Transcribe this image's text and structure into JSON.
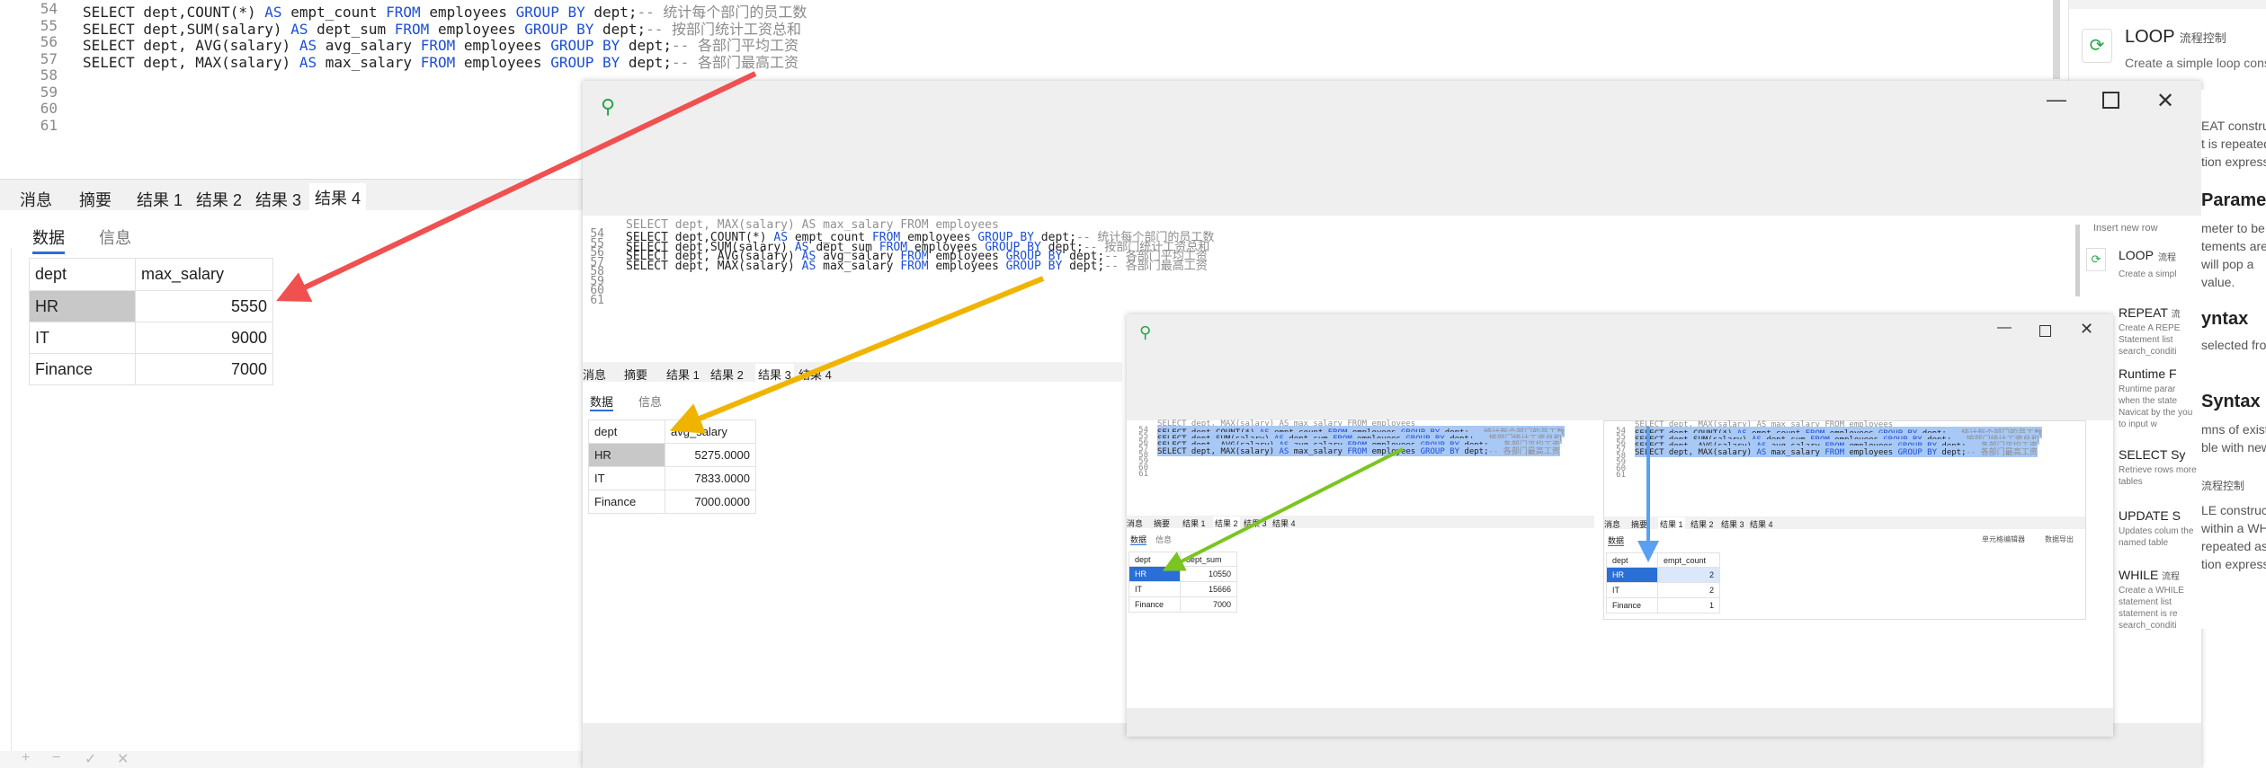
{
  "editor": {
    "lines": [
      {
        "n": "54",
        "parts": [
          {
            "t": "SELECT dept,COUNT(*) ",
            "c": ""
          },
          {
            "t": "AS",
            "c": "kw"
          },
          {
            "t": " empt_count ",
            "c": ""
          },
          {
            "t": "FROM",
            "c": "kw"
          },
          {
            "t": " employees ",
            "c": ""
          },
          {
            "t": "GROUP BY",
            "c": "kw"
          },
          {
            "t": " dept;",
            "c": ""
          },
          {
            "t": "-- 统计每个部门的员工数",
            "c": "cm"
          }
        ]
      },
      {
        "n": "55",
        "parts": [
          {
            "t": "SELECT dept,SUM(salary) ",
            "c": ""
          },
          {
            "t": "AS",
            "c": "kw"
          },
          {
            "t": " dept_sum ",
            "c": ""
          },
          {
            "t": "FROM",
            "c": "kw"
          },
          {
            "t": " employees ",
            "c": ""
          },
          {
            "t": "GROUP BY",
            "c": "kw"
          },
          {
            "t": " dept;",
            "c": ""
          },
          {
            "t": "-- 按部门统计工资总和",
            "c": "cm"
          }
        ]
      },
      {
        "n": "56",
        "parts": [
          {
            "t": "SELECT dept, AVG(salary) ",
            "c": ""
          },
          {
            "t": "AS",
            "c": "kw"
          },
          {
            "t": " avg_salary ",
            "c": ""
          },
          {
            "t": "FROM",
            "c": "kw"
          },
          {
            "t": " employees ",
            "c": ""
          },
          {
            "t": "GROUP BY",
            "c": "kw"
          },
          {
            "t": " dept;",
            "c": ""
          },
          {
            "t": "-- 各部门平均工资",
            "c": "cm"
          }
        ]
      },
      {
        "n": "57",
        "parts": [
          {
            "t": "SELECT dept, MAX(salary) ",
            "c": ""
          },
          {
            "t": "AS",
            "c": "kw"
          },
          {
            "t": " max_salary ",
            "c": ""
          },
          {
            "t": "FROM",
            "c": "kw"
          },
          {
            "t": " employees ",
            "c": ""
          },
          {
            "t": "GROUP BY",
            "c": "kw"
          },
          {
            "t": " dept;",
            "c": ""
          },
          {
            "t": "-- 各部门最高工资",
            "c": "cm"
          }
        ]
      },
      {
        "n": "58",
        "parts": []
      },
      {
        "n": "59",
        "parts": []
      },
      {
        "n": "60",
        "parts": []
      },
      {
        "n": "61",
        "parts": []
      }
    ],
    "pre_line": "SELECT dept, MAX(salary) AS max_salary FROM employees"
  },
  "result_tabs": [
    "消息",
    "摘要",
    "结果 1",
    "结果 2",
    "结果 3",
    "结果 4"
  ],
  "sub_tabs": [
    "数据",
    "信息"
  ],
  "grid_main": {
    "headers": [
      "dept",
      "max_salary"
    ],
    "rows": [
      [
        "HR",
        "5550"
      ],
      [
        "IT",
        "9000"
      ],
      [
        "Finance",
        "7000"
      ]
    ]
  },
  "grid_avg": {
    "headers": [
      "dept",
      "avg_salary"
    ],
    "rows": [
      [
        "HR",
        "5275.0000"
      ],
      [
        "IT",
        "7833.0000"
      ],
      [
        "Finance",
        "7000.0000"
      ]
    ]
  },
  "grid_sum": {
    "headers": [
      "dept",
      "dept_sum"
    ],
    "rows": [
      [
        "HR",
        "10550"
      ],
      [
        "IT",
        "15666"
      ],
      [
        "Finance",
        "7000"
      ]
    ]
  },
  "grid_count": {
    "headers": [
      "dept",
      "empt_count"
    ],
    "rows": [
      [
        "HR",
        "2"
      ],
      [
        "IT",
        "2"
      ],
      [
        "Finance",
        "1"
      ]
    ]
  },
  "small_toolbar": {
    "left": "单元格编辑器",
    "right": "数据导出"
  },
  "side_panel": {
    "loop_title": "LOOP",
    "loop_tag": "流程控制",
    "loop_desc": "Create a simple loop cons",
    "frag1": "EAT constru",
    "frag2": "t is repeated",
    "frag3": "tion expressi",
    "param_title": "Parame",
    "frag4": "meter to be",
    "frag5": "tements are",
    "frag6": "will pop a",
    "frag7": "value.",
    "syntax_title": "yntax",
    "syntax_sub": "selected fro",
    "syntax2_title": "Syntax",
    "frag8": "mns of exist",
    "frag9": "ble with new",
    "flow": "流程控制",
    "frag10": "LE construc",
    "frag11": "within a WH",
    "frag12": "repeated as",
    "frag13": "tion expressi",
    "insert_desc": "Insert new row",
    "items": [
      {
        "title": "LOOP",
        "tag": "流程",
        "desc": "Create a simpl"
      },
      {
        "title": "REPEAT",
        "tag": "流",
        "desc": "Create A REPE Statement list search_conditi"
      },
      {
        "title": "Runtime F",
        "tag": "",
        "desc": "Runtime parar when the state Navicat by the you to input w"
      },
      {
        "title": "SELECT Sy",
        "tag": "",
        "desc": "Retrieve rows more tables"
      },
      {
        "title": "UPDATE S",
        "tag": "",
        "desc": "Updates colum the named table"
      },
      {
        "title": "WHILE",
        "tag": "流程",
        "desc": "Create a WHILE statement list statement is re search_conditi"
      }
    ]
  },
  "icons": [
    "pin-icon",
    "minimize-icon",
    "maximize-icon",
    "close-icon",
    "loop-icon"
  ],
  "colors": {
    "keyword": "#1d4fd6",
    "comment": "#8c8c8c",
    "arrow_red": "#f05050",
    "arrow_yellow": "#f0b400",
    "arrow_green": "#7ac520",
    "arrow_blue": "#5aa0f0",
    "selection": "#a8c8f5"
  }
}
